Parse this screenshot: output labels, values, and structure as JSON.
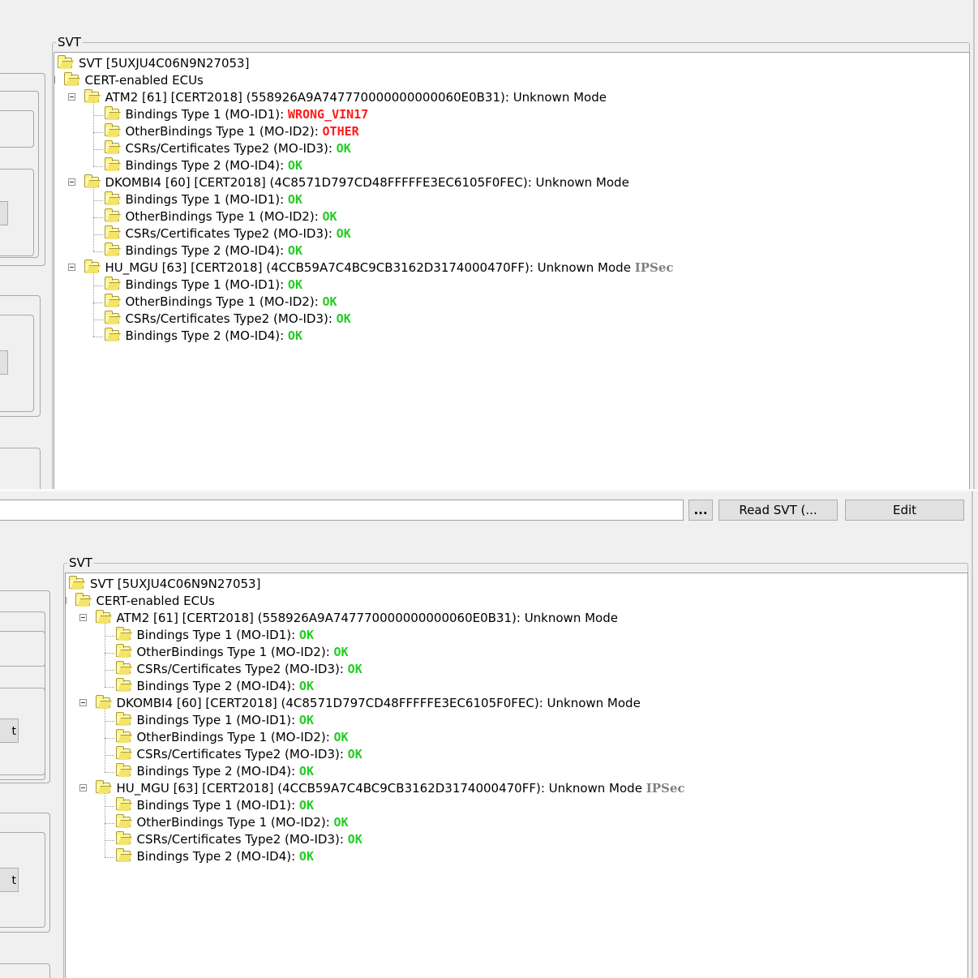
{
  "screen_top": {
    "group_label": "SVT",
    "left_button_labels": [
      "",
      ""
    ],
    "tree": {
      "root": "SVT [5UXJU4C06N9N27053]",
      "group": "CERT-enabled ECUs",
      "ecus": [
        {
          "label": "ATM2 [61] [CERT2018] (558926A9A747770000000000060E0B31): Unknown Mode",
          "extra": "",
          "items": [
            {
              "label": "Bindings Type 1 (MO-ID1): ",
              "status": "WRONG_VIN17",
              "state": "error"
            },
            {
              "label": "OtherBindings Type 1 (MO-ID2): ",
              "status": "OTHER",
              "state": "error"
            },
            {
              "label": "CSRs/Certificates Type2 (MO-ID3): ",
              "status": "OK",
              "state": "ok"
            },
            {
              "label": "Bindings Type 2 (MO-ID4): ",
              "status": "OK",
              "state": "ok"
            }
          ]
        },
        {
          "label": "DKOMBI4 [60] [CERT2018] (4C8571D797CD48FFFFFE3EC6105F0FEC): Unknown Mode",
          "extra": "",
          "items": [
            {
              "label": "Bindings Type 1 (MO-ID1): ",
              "status": "OK",
              "state": "ok"
            },
            {
              "label": "OtherBindings Type 1 (MO-ID2): ",
              "status": "OK",
              "state": "ok"
            },
            {
              "label": "CSRs/Certificates Type2 (MO-ID3): ",
              "status": "OK",
              "state": "ok"
            },
            {
              "label": "Bindings Type 2 (MO-ID4): ",
              "status": "OK",
              "state": "ok"
            }
          ]
        },
        {
          "label": "HU_MGU [63] [CERT2018] (4CCB59A7C4BC9CB3162D3174000470FF): Unknown Mode",
          "extra": "IPSec",
          "items": [
            {
              "label": "Bindings Type 1 (MO-ID1): ",
              "status": "OK",
              "state": "ok"
            },
            {
              "label": "OtherBindings Type 1 (MO-ID2): ",
              "status": "OK",
              "state": "ok"
            },
            {
              "label": "CSRs/Certificates Type2 (MO-ID3): ",
              "status": "OK",
              "state": "ok"
            },
            {
              "label": "Bindings Type 2 (MO-ID4): ",
              "status": "OK",
              "state": "ok"
            }
          ]
        }
      ]
    }
  },
  "toolbar": {
    "path_value": "",
    "browse_label": "...",
    "read_label": "Read SVT (...",
    "edit_label": "Edit"
  },
  "screen_bottom": {
    "group_label": "SVT",
    "left_button_labels": [
      "t",
      "t"
    ],
    "tree": {
      "root": "SVT [5UXJU4C06N9N27053]",
      "group": "CERT-enabled ECUs",
      "ecus": [
        {
          "label": "ATM2 [61] [CERT2018] (558926A9A747770000000000060E0B31): Unknown Mode",
          "extra": "",
          "items": [
            {
              "label": "Bindings Type 1 (MO-ID1): ",
              "status": "OK",
              "state": "ok"
            },
            {
              "label": "OtherBindings Type 1 (MO-ID2): ",
              "status": "OK",
              "state": "ok"
            },
            {
              "label": "CSRs/Certificates Type2 (MO-ID3): ",
              "status": "OK",
              "state": "ok"
            },
            {
              "label": "Bindings Type 2 (MO-ID4): ",
              "status": "OK",
              "state": "ok"
            }
          ]
        },
        {
          "label": "DKOMBI4 [60] [CERT2018] (4C8571D797CD48FFFFFE3EC6105F0FEC): Unknown Mode",
          "extra": "",
          "items": [
            {
              "label": "Bindings Type 1 (MO-ID1): ",
              "status": "OK",
              "state": "ok"
            },
            {
              "label": "OtherBindings Type 1 (MO-ID2): ",
              "status": "OK",
              "state": "ok"
            },
            {
              "label": "CSRs/Certificates Type2 (MO-ID3): ",
              "status": "OK",
              "state": "ok"
            },
            {
              "label": "Bindings Type 2 (MO-ID4): ",
              "status": "OK",
              "state": "ok"
            }
          ]
        },
        {
          "label": "HU_MGU [63] [CERT2018] (4CCB59A7C4BC9CB3162D3174000470FF): Unknown Mode",
          "extra": "IPSec",
          "items": [
            {
              "label": "Bindings Type 1 (MO-ID1): ",
              "status": "OK",
              "state": "ok"
            },
            {
              "label": "OtherBindings Type 1 (MO-ID2): ",
              "status": "OK",
              "state": "ok"
            },
            {
              "label": "CSRs/Certificates Type2 (MO-ID3): ",
              "status": "OK",
              "state": "ok"
            },
            {
              "label": "Bindings Type 2 (MO-ID4): ",
              "status": "OK",
              "state": "ok"
            }
          ]
        }
      ]
    }
  },
  "colors": {
    "ok": "#22cc22",
    "error": "#ff1a1a",
    "ipsec": "#808080"
  },
  "icons": {
    "tree_node": "folder-icon",
    "collapse": "collapse-box-icon"
  }
}
